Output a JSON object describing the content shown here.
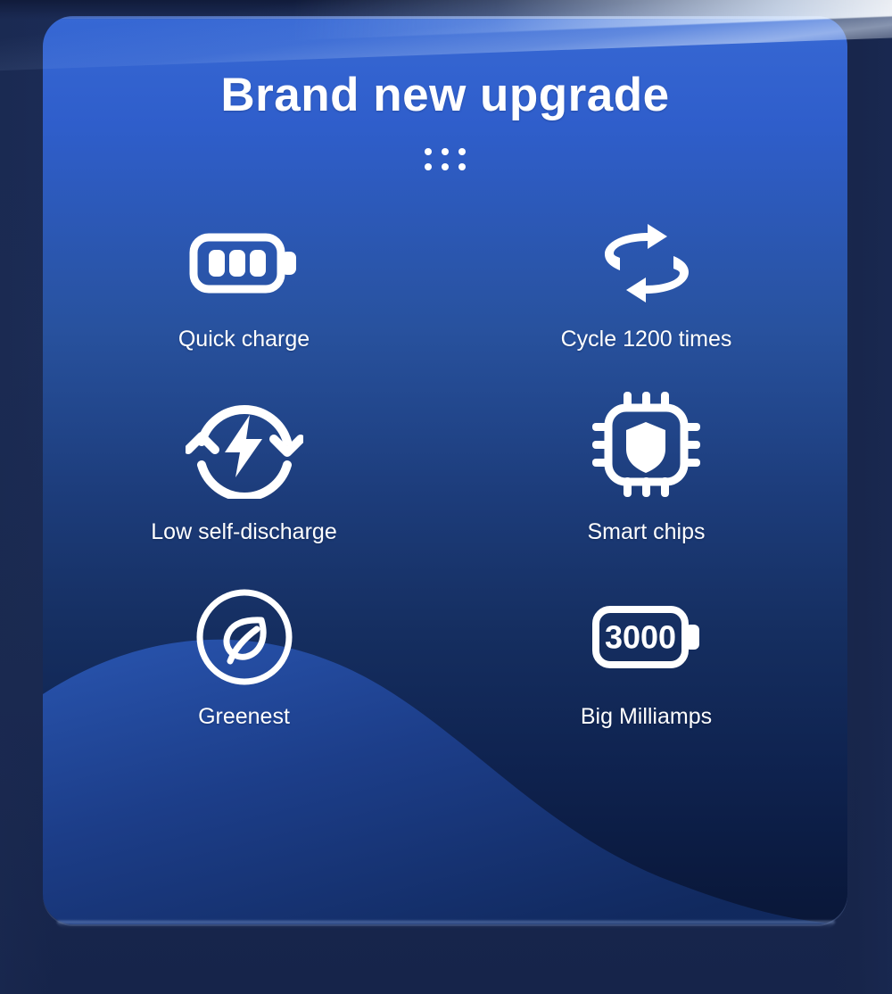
{
  "page": {
    "background_color": "#16244a",
    "card_gradient_top": "#3768d4",
    "card_gradient_bottom": "#0a1738",
    "accent_color": "#ffffff"
  },
  "header": {
    "title": "Brand new upgrade",
    "decor_icon": "dot-grid-icon",
    "decor_dot_count": 6
  },
  "features": [
    {
      "icon": "battery-three-bars-icon",
      "label": "Quick charge"
    },
    {
      "icon": "cycle-rotate-arrows-icon",
      "label": "Cycle 1200 times"
    },
    {
      "icon": "refresh-lightning-icon",
      "label": "Low self-discharge"
    },
    {
      "icon": "cpu-shield-chip-icon",
      "label": "Smart chips"
    },
    {
      "icon": "leaf-circle-icon",
      "label": "Greenest"
    },
    {
      "icon": "battery-capacity-icon",
      "label": "Big Milliamps",
      "badge_value": "3000"
    }
  ]
}
